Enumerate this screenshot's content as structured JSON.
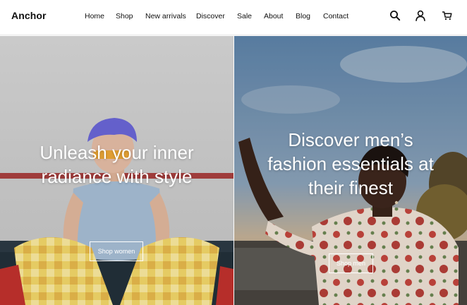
{
  "header": {
    "logo": "Anchor",
    "nav": [
      {
        "label": "Home"
      },
      {
        "label": "Shop"
      },
      {
        "label": "New arrivals"
      },
      {
        "label": "Discover"
      },
      {
        "label": "Sale"
      },
      {
        "label": "About"
      },
      {
        "label": "Blog"
      },
      {
        "label": "Contact"
      }
    ],
    "icons": [
      "search-icon",
      "account-icon",
      "cart-icon"
    ]
  },
  "hero_left": {
    "heading": "Unleash your inner radiance with style",
    "button_label": "Shop women"
  },
  "hero_right": {
    "heading": "Discover men’s fashion essentials at their finest",
    "button_label": "Shop men"
  },
  "colors": {
    "header_bg": "#ffffff",
    "text": "#111111",
    "hero_text": "#ffffff"
  }
}
